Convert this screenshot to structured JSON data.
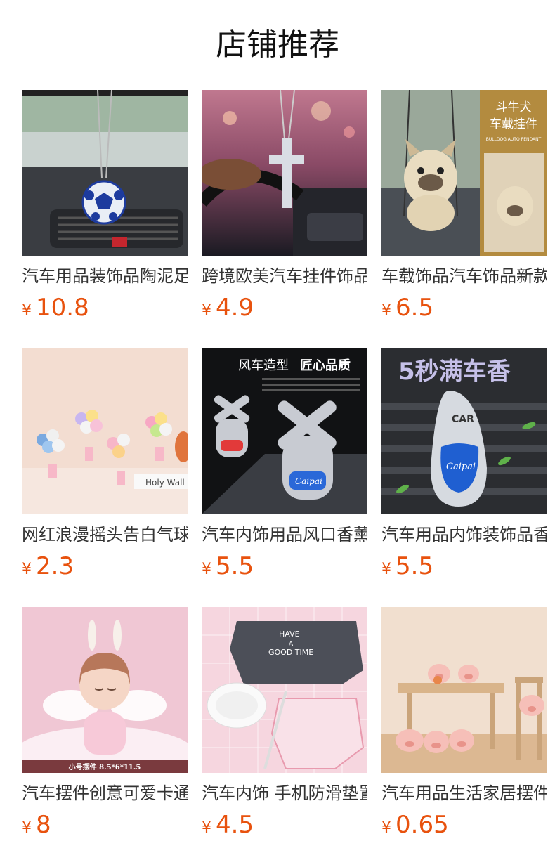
{
  "section_title": "店铺推荐",
  "currency_symbol": "¥",
  "accent_color": "#e8520e",
  "products": [
    {
      "name": "汽车用品装饰品陶泥足球挂件",
      "price": "10.8",
      "image": "soccer-ball-pendant"
    },
    {
      "name": "跨境欧美汽车挂件饰品十字架",
      "price": "4.9",
      "image": "cross-pendant"
    },
    {
      "name": "车载饰品汽车饰品新款斗牛犬",
      "price": "6.5",
      "image": "bulldog-swing"
    },
    {
      "name": "网红浪漫摇头告白气球摆件",
      "price": "2.3",
      "image": "balloon-ornament"
    },
    {
      "name": "汽车内饰用品风口香薰风车",
      "price": "5.5",
      "image": "windmill-vent-clip"
    },
    {
      "name": "汽车用品内饰装饰品香水夹",
      "price": "5.5",
      "image": "vent-perfume"
    },
    {
      "name": "汽车摆件创意可爱卡通天使",
      "price": "8",
      "image": "angel-doll"
    },
    {
      "name": "汽车内饰 手机防滑垫置物",
      "price": "4.5",
      "image": "anti-slip-mat"
    },
    {
      "name": "汽车用品生活家居摆件小猪",
      "price": "0.65",
      "image": "pig-figurines"
    }
  ],
  "image_texts": {
    "bulldog_title": "斗牛犬",
    "bulldog_sub": "车载挂件",
    "bulldog_en": "BULLDOG AUTO PENDANT",
    "balloon_sign": "Holy Wall",
    "windmill_title_a": "风车造型",
    "windmill_title_b": "匠心品质",
    "windmill_brand": "Caipai",
    "perfume_title": "5秒满车香",
    "perfume_brand": "Caipai",
    "perfume_car": "CAR",
    "angel_size": "小号摆件  8.5*6*11.5",
    "mat_text_a": "HAVE",
    "mat_text_b": "A",
    "mat_text_c": "GOOD TIME"
  }
}
